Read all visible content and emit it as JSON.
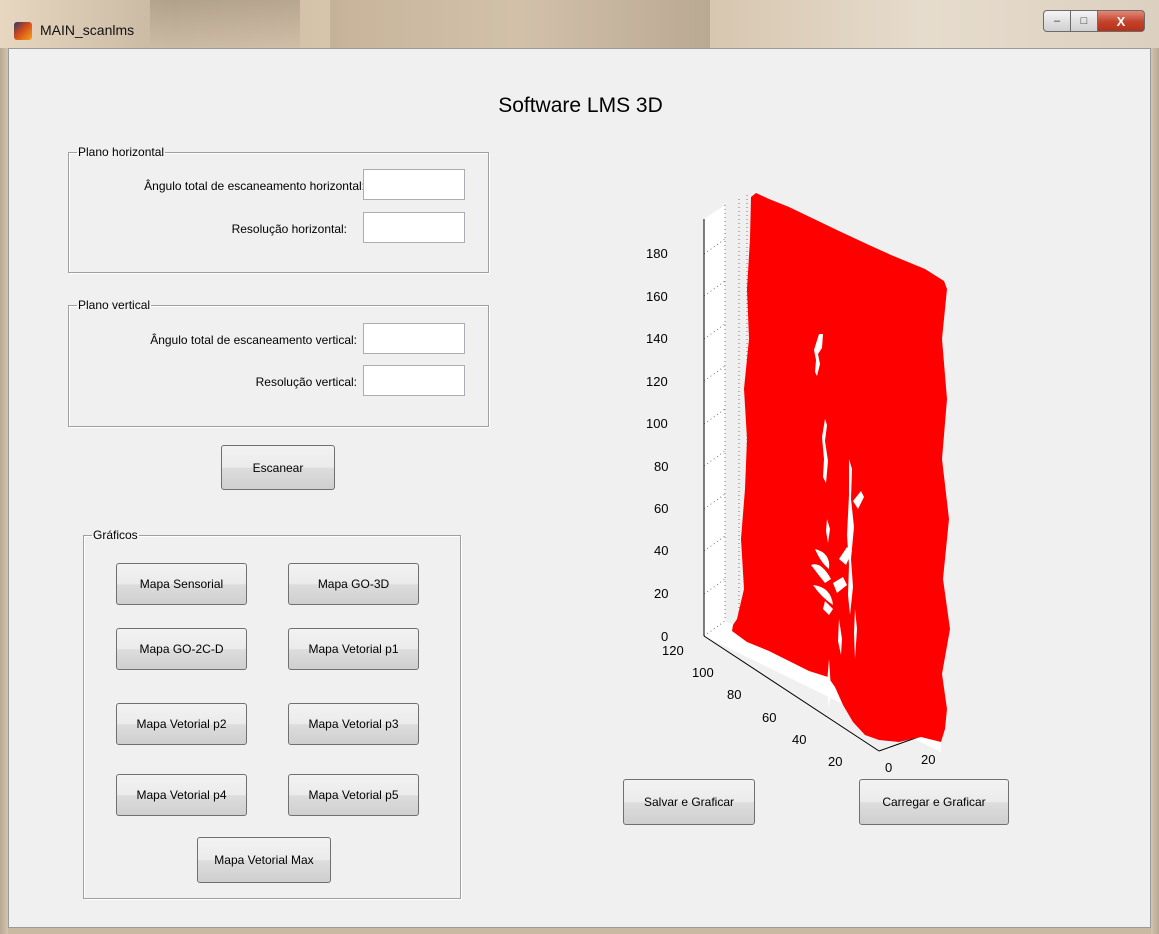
{
  "window": {
    "title": "MAIN_scanlms",
    "min": "–",
    "max": "□",
    "close": "X"
  },
  "app_title": "Software LMS 3D",
  "horizontal": {
    "legend": "Plano horizontal",
    "angle_label": "Ângulo total de escaneamento horizontal:",
    "angle_value": "",
    "resolution_label": "Resolução horizontal:",
    "resolution_value": ""
  },
  "vertical": {
    "legend": "Plano vertical",
    "angle_label": "Ângulo total de escaneamento vertical:",
    "angle_value": "",
    "resolution_label": "Resolução vertical:",
    "resolution_value": ""
  },
  "scan_button": "Escanear",
  "graphs": {
    "legend": "Gráficos",
    "buttons": [
      "Mapa Sensorial",
      "Mapa GO-3D",
      "Mapa GO-2C-D",
      "Mapa Vetorial p1",
      "Mapa Vetorial p2",
      "Mapa Vetorial p3",
      "Mapa Vetorial p4",
      "Mapa Vetorial p5",
      "Mapa Vetorial Max"
    ]
  },
  "save_button": "Salvar e Graficar",
  "load_button": "Carregar e Graficar",
  "plot": {
    "color": "#ff0000",
    "z_ticks": [
      "0",
      "20",
      "40",
      "60",
      "80",
      "100",
      "120",
      "140",
      "160",
      "180"
    ],
    "y_ticks": [
      "120",
      "100",
      "80",
      "60",
      "40",
      "20"
    ],
    "x_ticks": [
      "0",
      "20"
    ]
  }
}
